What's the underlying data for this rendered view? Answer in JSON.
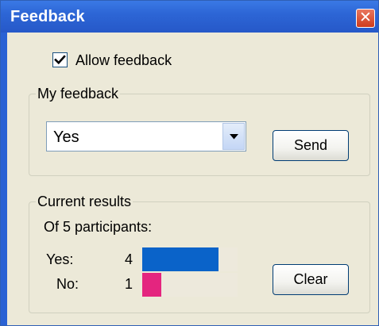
{
  "window": {
    "title": "Feedback",
    "close_glyph": "✕"
  },
  "allow_feedback": {
    "label": "Allow feedback",
    "checked": true
  },
  "my_feedback": {
    "group_label": "My feedback",
    "selected_option": "Yes",
    "send_label": "Send"
  },
  "results": {
    "group_label": "Current results",
    "summary": "Of 5 participants:",
    "total": 5,
    "yes": {
      "label": "Yes:",
      "count": "4",
      "value": 4,
      "color": "#0a63c9"
    },
    "no": {
      "label": "No:",
      "count": "1",
      "value": 1,
      "color": "#e4257f"
    },
    "clear_label": "Clear"
  },
  "colors": {
    "titlebar": "#2d66d6",
    "panel_bg": "#ece9d8",
    "bar_track": "#ede9dc"
  },
  "icons": {
    "close": "close-icon",
    "checkbox": "checkmark-icon",
    "dropdown": "chevron-down-icon"
  }
}
